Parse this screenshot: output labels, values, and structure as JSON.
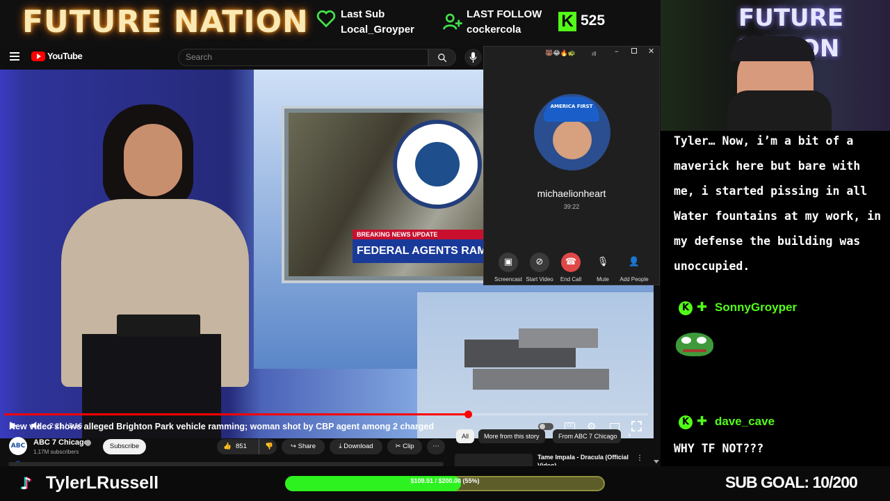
{
  "overlay": {
    "brand": "FUTURE NATION",
    "last_sub_label": "Last Sub",
    "last_sub_name": "Local_Groyper",
    "last_follow_label": "LAST FOLLOW",
    "last_follow_name": "cockercola",
    "kick_viewers": "525",
    "kick_letter": "K",
    "streamer_name": "TylerLRussell",
    "goal_progress_text": "$109.51 / $200.00 (55%)",
    "goal_fraction": 0.55,
    "sub_goal": "SUB GOAL: 10/200",
    "accent_green": "#53fc18"
  },
  "youtube": {
    "logo_text": "YouTube",
    "search_placeholder": "Search",
    "video": {
      "breaking_label": "BREAKING NEWS UPDATE",
      "breaking_headline": "FEDERAL AGENTS RAM",
      "time": "2:21 / 3:16",
      "progress_fraction": 0.72
    },
    "title": "New video shows alleged Brighton Park vehicle ramming; woman shot by CBP agent among 2 charged",
    "channel": {
      "logo_text": "ABC 7",
      "name": "ABC 7 Chicago",
      "subscribers": "1.17M subscribers",
      "subscribe_label": "Subscribe"
    },
    "actions": {
      "likes": "851",
      "share": "Share",
      "download": "Download",
      "clip": "Clip"
    },
    "chips": [
      "All",
      "More from this story",
      "From ABC 7 Chicago"
    ],
    "rec_title": "Tame Impala - Dracula (Official Video)"
  },
  "call": {
    "username": "michaelionheart",
    "duration": "39:22",
    "cap_text": "AMERICA FIRST",
    "buttons": {
      "screencast": "Screencast",
      "start_video": "Start Video",
      "end_call": "End Call",
      "mute": "Mute",
      "add_people": "Add People"
    }
  },
  "chat": {
    "message_top": "Tyler… Now, i’m a bit of a maverick here but bare with me, i started pissing in all Water fountains at my work, in my defense the building was unoccupied.",
    "user1": "SonnyGroyper",
    "user2": "dave_cave",
    "user2_msg": "WHY TF NOT???"
  }
}
